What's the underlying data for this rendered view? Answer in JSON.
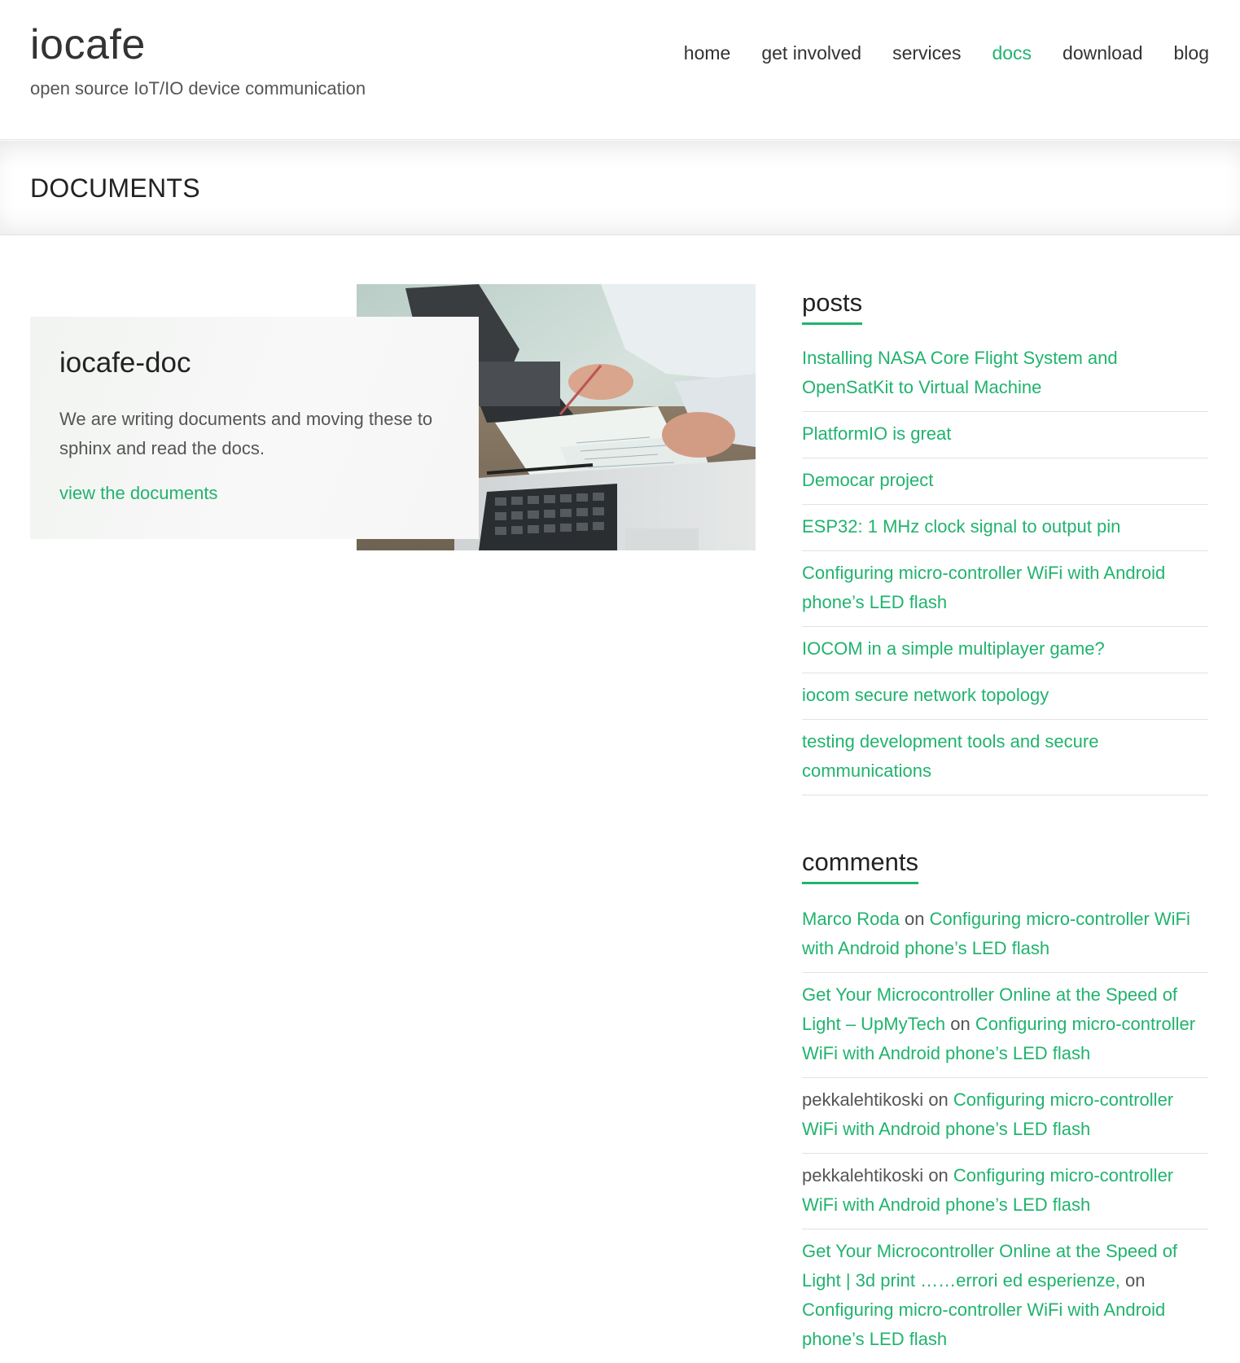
{
  "site": {
    "title": "iocafe",
    "tagline": "open source IoT/IO device communication"
  },
  "nav": {
    "items": [
      {
        "label": "home",
        "active": false
      },
      {
        "label": "get involved",
        "active": false
      },
      {
        "label": "services",
        "active": false
      },
      {
        "label": "docs",
        "active": true
      },
      {
        "label": "download",
        "active": false
      },
      {
        "label": "blog",
        "active": false
      }
    ],
    "active_color": "#21b36e"
  },
  "page": {
    "title": "DOCUMENTS"
  },
  "feature": {
    "title": "iocafe-doc",
    "text": "We are writing documents and moving these to sphinx and read the docs.",
    "link_label": "view the documents"
  },
  "sidebar": {
    "posts": {
      "title": "posts",
      "items": [
        "Installing NASA Core Flight System and OpenSatKit to Virtual Machine",
        "PlatformIO is great",
        "Democar project",
        "ESP32: 1 MHz clock signal to output pin",
        "Configuring micro-controller WiFi with Android phone’s LED flash",
        "IOCOM in a simple multiplayer game?",
        "iocom secure network topology",
        "testing development tools and secure communications"
      ]
    },
    "comments": {
      "title": "comments",
      "connector": "on",
      "items": [
        {
          "author": "Marco Roda",
          "author_linked": true,
          "post": "Configuring micro-controller WiFi with Android phone’s LED flash"
        },
        {
          "author": "Get Your Microcontroller Online at the Speed of Light – UpMyTech",
          "author_linked": true,
          "post": "Configuring micro-controller WiFi with Android phone’s LED flash"
        },
        {
          "author": "pekkalehtikoski",
          "author_linked": false,
          "post": "Configuring micro-controller WiFi with Android phone’s LED flash"
        },
        {
          "author": "pekkalehtikoski",
          "author_linked": false,
          "post": "Configuring micro-controller WiFi with Android phone’s LED flash"
        },
        {
          "author": "Get Your Microcontroller Online at the Speed of Light | 3d print ……errori ed esperienze,",
          "author_linked": true,
          "post": "Configuring micro-controller WiFi with Android phone’s LED flash"
        }
      ]
    }
  },
  "colors": {
    "accent": "#21b36e",
    "text": "#333333",
    "muted": "#555555"
  }
}
